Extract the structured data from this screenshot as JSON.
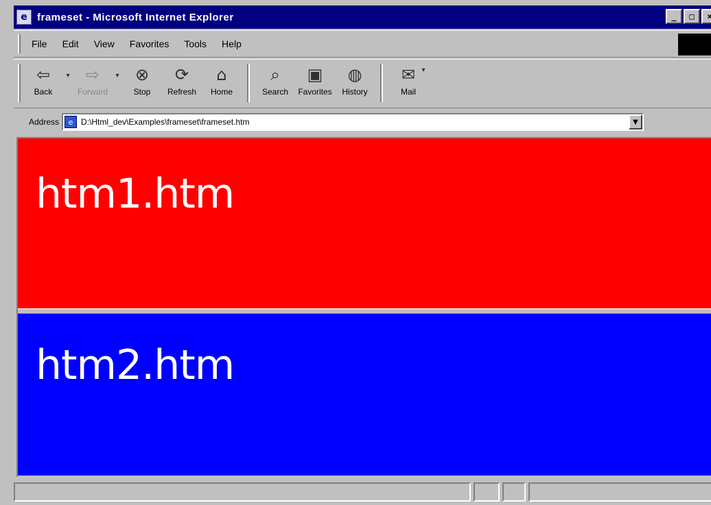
{
  "window": {
    "title": "frameset - Microsoft Internet Explorer",
    "buttons": {
      "minimize": "_",
      "maximize": "□",
      "close": "×"
    }
  },
  "menu": {
    "items": [
      "File",
      "Edit",
      "View",
      "Favorites",
      "Tools",
      "Help"
    ]
  },
  "toolbar": {
    "back": "Back",
    "forward": "Forward",
    "stop": "Stop",
    "refresh": "Refresh",
    "home": "Home",
    "search": "Search",
    "favorites": "Favorites",
    "history": "History",
    "mail": "Mail",
    "icons": {
      "back": "back-arrow-icon",
      "forward": "forward-arrow-icon",
      "stop": "stop-icon",
      "refresh": "refresh-icon",
      "home": "home-icon",
      "search": "search-icon",
      "favorites": "favorites-icon",
      "history": "history-icon",
      "mail": "mail-icon"
    }
  },
  "address": {
    "label": "Address",
    "value": "D:\\Html_dev\\Examples\\frameset\\frameset.htm"
  },
  "frames": {
    "top": {
      "text": "htm1.htm",
      "color": "#ff0000"
    },
    "bottom": {
      "text": "htm2.htm",
      "color": "#0000ff"
    }
  },
  "status": {
    "text": ""
  }
}
